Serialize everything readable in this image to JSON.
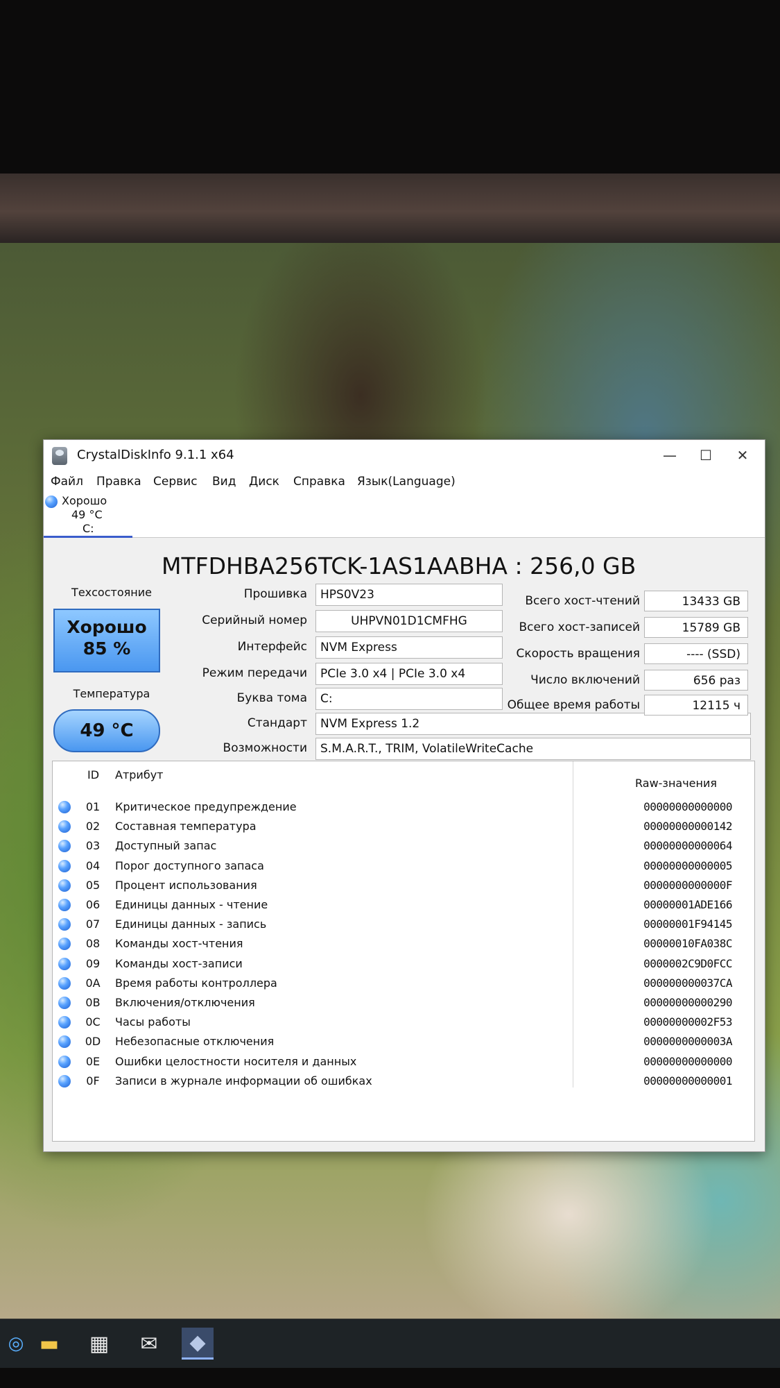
{
  "window": {
    "title": "CrystalDiskInfo 9.1.1 x64",
    "controls": {
      "minimize": "—",
      "maximize": "☐",
      "close": "✕"
    }
  },
  "menu": [
    "Файл",
    "Правка",
    "Сервис",
    "Вид",
    "Диск",
    "Справка",
    "Язык(Language)"
  ],
  "drive_tab": {
    "status": "Хорошо",
    "temp": "49 °C",
    "letter": "C:"
  },
  "model": "MTFDHBA256TCK-1AS1AABHA : 256,0 GB",
  "health": {
    "label": "Техсостояние",
    "value": "Хорошо",
    "percent": "85 %"
  },
  "temperature": {
    "label": "Температура",
    "value": "49 °C"
  },
  "info": [
    {
      "label": "Прошивка",
      "value": "HPS0V23"
    },
    {
      "label": "Серийный номер",
      "value": "UHPVN01D1CMFHG"
    },
    {
      "label": "Интерфейс",
      "value": "NVM Express"
    },
    {
      "label": "Режим передачи",
      "value": "PCIe 3.0 x4 | PCIe 3.0 x4"
    },
    {
      "label": "Буква тома",
      "value": "C:"
    },
    {
      "label": "Стандарт",
      "value": "NVM Express 1.2"
    },
    {
      "label": "Возможности",
      "value": "S.M.A.R.T., TRIM, VolatileWriteCache"
    }
  ],
  "stats": [
    {
      "label": "Всего хост-чтений",
      "value": "13433 GB"
    },
    {
      "label": "Всего хост-записей",
      "value": "15789 GB"
    },
    {
      "label": "Скорость вращения",
      "value": "---- (SSD)"
    },
    {
      "label": "Число включений",
      "value": "656 раз"
    },
    {
      "label": "Общее время работы",
      "value": "12115 ч"
    }
  ],
  "table": {
    "headers": {
      "id": "ID",
      "attribute": "Атрибут",
      "raw": "Raw-значения"
    },
    "rows": [
      {
        "id": "01",
        "name": "Критическое предупреждение",
        "raw": "00000000000000"
      },
      {
        "id": "02",
        "name": "Составная температура",
        "raw": "00000000000142"
      },
      {
        "id": "03",
        "name": "Доступный запас",
        "raw": "00000000000064"
      },
      {
        "id": "04",
        "name": "Порог доступного запаса",
        "raw": "00000000000005"
      },
      {
        "id": "05",
        "name": "Процент использования",
        "raw": "0000000000000F"
      },
      {
        "id": "06",
        "name": "Единицы данных - чтение",
        "raw": "00000001ADE166"
      },
      {
        "id": "07",
        "name": "Единицы данных - запись",
        "raw": "00000001F94145"
      },
      {
        "id": "08",
        "name": "Команды хост-чтения",
        "raw": "00000010FA038C"
      },
      {
        "id": "09",
        "name": "Команды хост-записи",
        "raw": "0000002C9D0FCC"
      },
      {
        "id": "0A",
        "name": "Время работы контроллера",
        "raw": "000000000037CA"
      },
      {
        "id": "0B",
        "name": "Включения/отключения",
        "raw": "00000000000290"
      },
      {
        "id": "0C",
        "name": "Часы работы",
        "raw": "00000000002F53"
      },
      {
        "id": "0D",
        "name": "Небезопасные отключения",
        "raw": "0000000000003A"
      },
      {
        "id": "0E",
        "name": "Ошибки целостности носителя и данных",
        "raw": "00000000000000"
      },
      {
        "id": "0F",
        "name": "Записи в журнале информации об ошибках",
        "raw": "00000000000001"
      }
    ]
  },
  "taskbar": [
    {
      "name": "start-icon",
      "glyph": "◎"
    },
    {
      "name": "file-explorer-icon",
      "glyph": "▬"
    },
    {
      "name": "store-icon",
      "glyph": "▦"
    },
    {
      "name": "mail-icon",
      "glyph": "✉"
    },
    {
      "name": "crystaldiskinfo-taskbar-icon",
      "glyph": "◆"
    }
  ],
  "colors": {
    "accent": "#3a5ccc",
    "health_blue": "#4a97f0"
  }
}
